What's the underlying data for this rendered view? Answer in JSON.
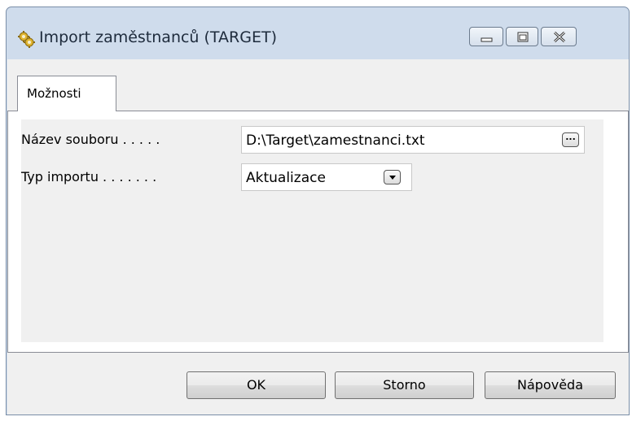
{
  "window": {
    "title": "Import zaměstnanců (TARGET)",
    "icon": "gear-icon",
    "controls": {
      "minimize_icon": "minimize-icon",
      "maximize_icon": "maximize-icon",
      "close_icon": "close-icon"
    }
  },
  "tabs": [
    {
      "label": "Možnosti",
      "active": true
    }
  ],
  "form": {
    "file_label": "Název souboru . . . . .",
    "file_value": "D:\\Target\\zamestnanci.txt",
    "browse_label": "...",
    "type_label": "Typ importu . . . . . . .",
    "type_value": "Aktualizace"
  },
  "buttons": {
    "ok": "OK",
    "cancel": "Storno",
    "help": "Nápověda"
  },
  "colors": {
    "titlebar": "#cfdcec",
    "client": "#f0f0f0"
  }
}
